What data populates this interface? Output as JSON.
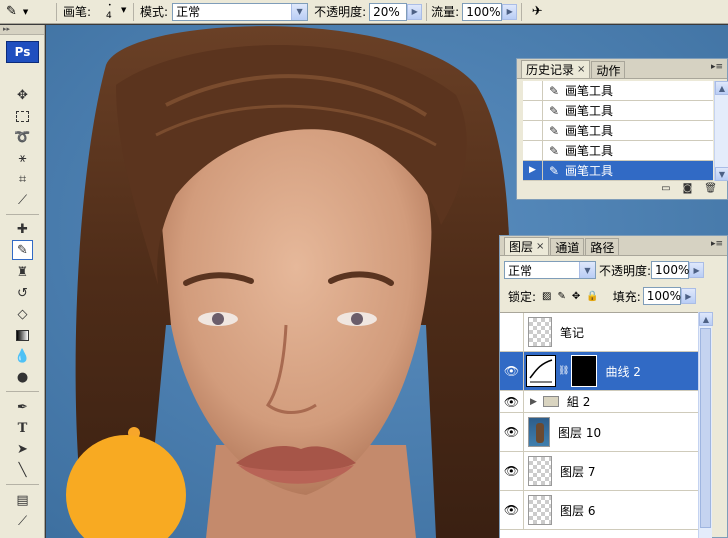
{
  "options_bar": {
    "brush_label": "画笔:",
    "brush_size": "4",
    "mode_label": "模式:",
    "mode_value": "正常",
    "opacity_label": "不透明度:",
    "opacity_value": "20%",
    "flow_label": "流量:",
    "flow_value": "100%"
  },
  "toolbox": {
    "logo": "Ps"
  },
  "history_panel": {
    "tabs": [
      {
        "label": "历史记录",
        "active": true
      },
      {
        "label": "动作",
        "active": false
      }
    ],
    "items": [
      {
        "label": "画笔工具",
        "selected": false
      },
      {
        "label": "画笔工具",
        "selected": false
      },
      {
        "label": "画笔工具",
        "selected": false
      },
      {
        "label": "画笔工具",
        "selected": false
      },
      {
        "label": "画笔工具",
        "selected": true
      }
    ]
  },
  "layers_panel": {
    "tabs": [
      {
        "label": "图层",
        "active": true
      },
      {
        "label": "通道",
        "active": false
      },
      {
        "label": "路径",
        "active": false
      }
    ],
    "blend_mode": "正常",
    "opacity_label": "不透明度:",
    "opacity_value": "100%",
    "lock_label": "锁定:",
    "fill_label": "填充:",
    "fill_value": "100%",
    "layers": [
      {
        "name": "笔记",
        "visible": false,
        "selected": false,
        "kind": "normal"
      },
      {
        "name": "曲线 2",
        "visible": true,
        "selected": true,
        "kind": "adjustment"
      },
      {
        "name": "組 2",
        "visible": true,
        "selected": false,
        "kind": "group"
      },
      {
        "name": "图层 10",
        "visible": true,
        "selected": false,
        "kind": "photo"
      },
      {
        "name": "图层 7",
        "visible": true,
        "selected": false,
        "kind": "normal"
      },
      {
        "name": "图层 6",
        "visible": true,
        "selected": false,
        "kind": "normal"
      }
    ]
  },
  "colors": {
    "selection": "#316ac5",
    "panel_bg": "#ece9d8",
    "canvas_bg": "#4a7fb0"
  }
}
